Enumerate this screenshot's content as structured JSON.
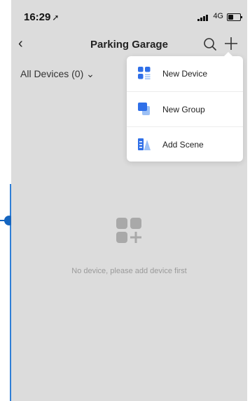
{
  "status_bar": {
    "time": "16:29",
    "location_glyph": "➚",
    "network": "4G"
  },
  "nav": {
    "back_glyph": "‹",
    "title": "Parking Garage"
  },
  "filter": {
    "label": "All Devices (0)",
    "chevron": "⌄"
  },
  "menu": {
    "items": [
      {
        "label": "New Device",
        "icon": "new-device-icon"
      },
      {
        "label": "New Group",
        "icon": "new-group-icon"
      },
      {
        "label": "Add Scene",
        "icon": "add-scene-icon"
      }
    ]
  },
  "empty": {
    "message": "No device, please add device first",
    "icon": "add-device-placeholder-icon"
  },
  "colors": {
    "accent": "#2f6fe8",
    "accent_light": "#9cc0f5",
    "screen_bg": "#dcdcdc",
    "edge_line": "#2f7fd6"
  }
}
